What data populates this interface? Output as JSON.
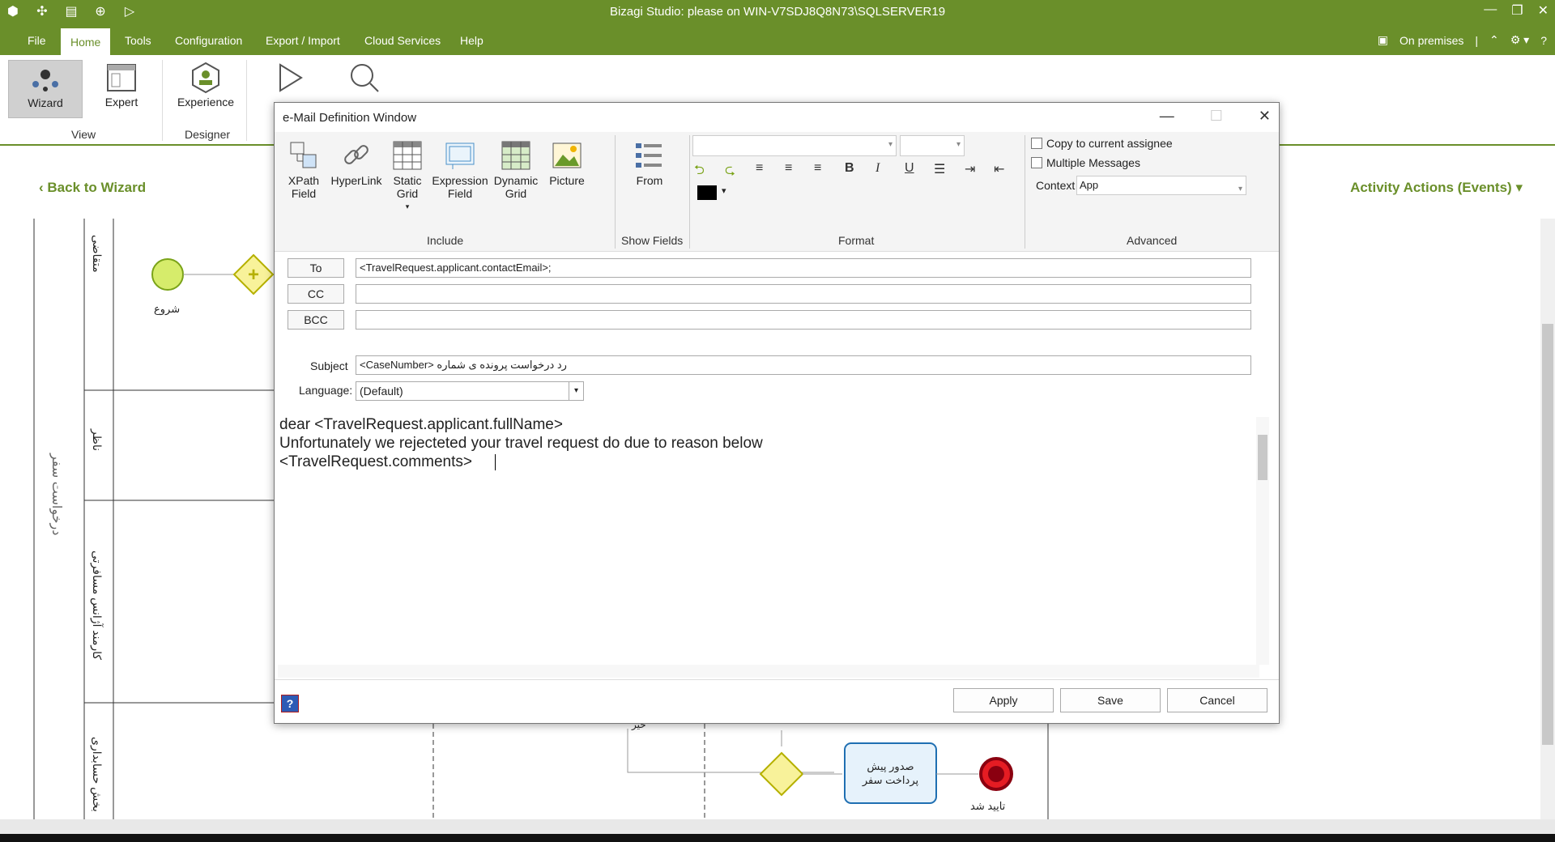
{
  "app": {
    "title": "Bizagi Studio: please  on WIN-V7SDJ8Q8N73\\SQLSERVER19",
    "menu": [
      "File",
      "Home",
      "Tools",
      "Configuration",
      "Export / Import",
      "Cloud Services",
      "Help"
    ],
    "active_menu": "Home",
    "on_premises": "On premises",
    "ribbon": {
      "wizard": "Wizard",
      "expert": "Expert",
      "experience": "Experience",
      "group_view": "View",
      "group_designer": "Designer"
    },
    "back_to_wizard": "Back to Wizard",
    "activity_actions": "Activity Actions (Events)"
  },
  "diagram": {
    "pool_label": "درخواست سفر",
    "lanes": [
      "متقاضی",
      "ناظر",
      "کارمند آژانس مسافرتی",
      "بخش حسابداری"
    ],
    "start_label": "شروع",
    "task_label": "صدور پیش پرداخت سفر",
    "end_label": "تایید شد",
    "edge_label": "خیر"
  },
  "dialog": {
    "title": "e-Mail Definition Window",
    "include": {
      "xpath": "XPath Field",
      "hyperlink": "HyperLink",
      "static_grid": "Static Grid",
      "expression": "Expression Field",
      "dynamic_grid": "Dynamic Grid",
      "picture": "Picture",
      "group": "Include"
    },
    "show_fields": {
      "from": "From",
      "group": "Show Fields"
    },
    "format": {
      "group": "Format",
      "bold": "B",
      "italic": "I",
      "underline": "U"
    },
    "advanced": {
      "copy_assignee": "Copy to current assignee",
      "multiple_messages": "Multiple Messages",
      "context_label": "Context",
      "context_value": "App",
      "group": "Advanced"
    },
    "to_label": "To",
    "to_value": "<TravelRequest.applicant.contactEmail>;",
    "cc_label": "CC",
    "bcc_label": "BCC",
    "subject_label": "Subject",
    "subject_value": "<CaseNumber> رد درخواست پرونده ی شماره",
    "language_label": "Language:",
    "language_value": "(Default)",
    "body_lines": [
      "dear <TravelRequest.applicant.fullName>",
      "Unfortunately we rejecteted your travel request do due to reason below",
      "<TravelRequest.comments>"
    ],
    "apply": "Apply",
    "save": "Save",
    "cancel": "Cancel"
  },
  "colors": {
    "brand": "#6a8f2a",
    "task_border": "#1f6fb2",
    "end_event": "#c8102e",
    "gateway": "#c8c800"
  }
}
